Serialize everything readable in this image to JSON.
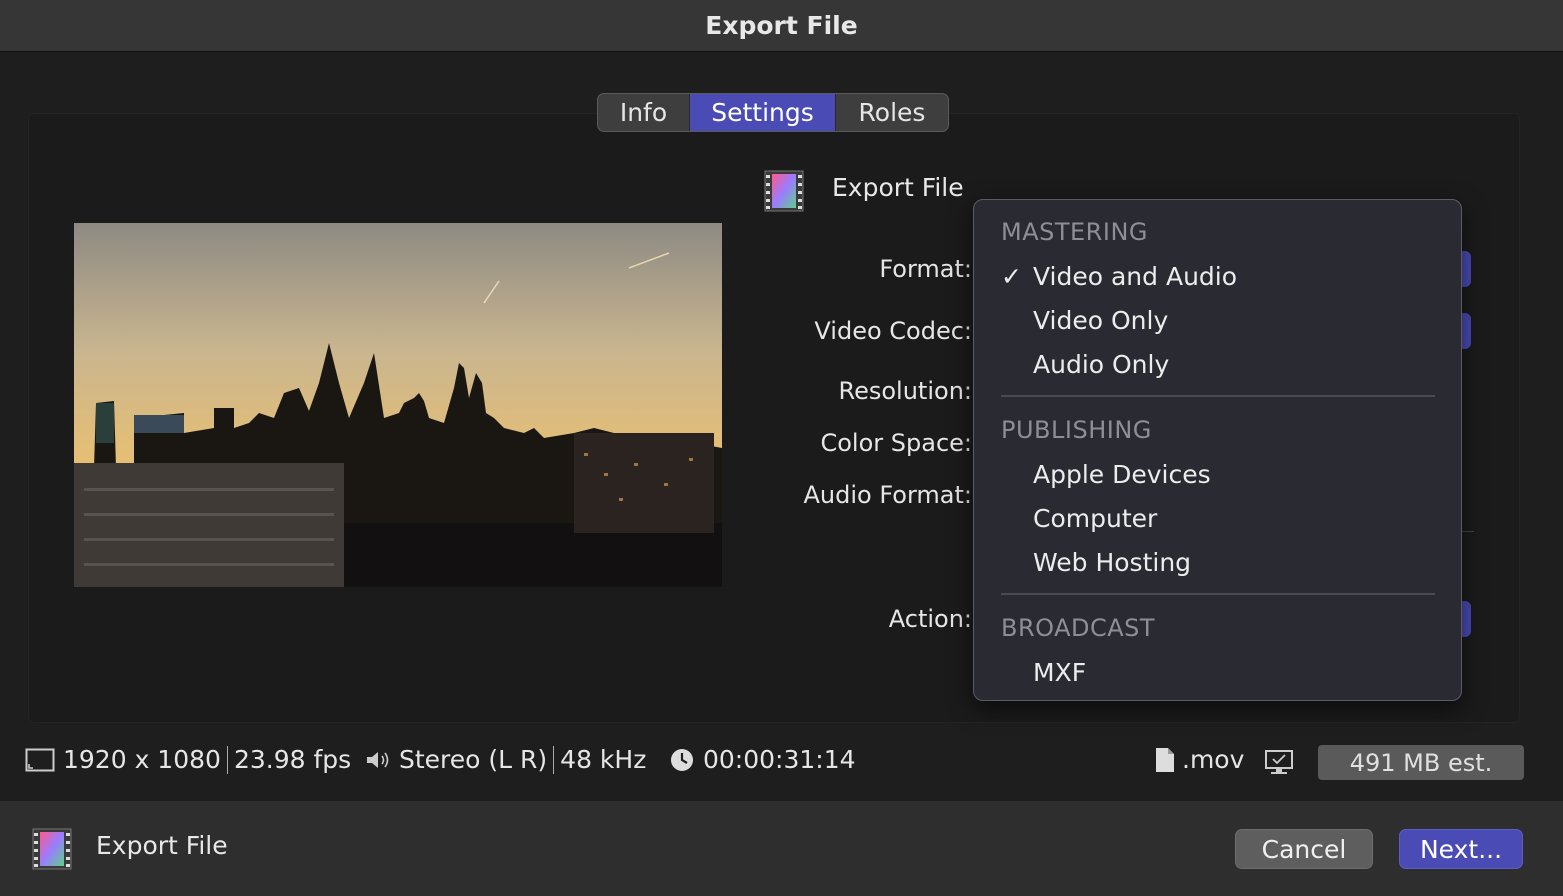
{
  "window": {
    "title": "Export File"
  },
  "tabs": [
    {
      "label": "Info",
      "active": false
    },
    {
      "label": "Settings",
      "active": true
    },
    {
      "label": "Roles",
      "active": false
    }
  ],
  "header": {
    "label": "Export File",
    "icon": "film-icon"
  },
  "settings": {
    "format_label": "Format:",
    "video_codec_label": "Video Codec:",
    "resolution_label": "Resolution:",
    "color_space_label": "Color Space:",
    "audio_format_label": "Audio Format:",
    "action_label": "Action:"
  },
  "format_menu": {
    "sections": [
      {
        "heading": "MASTERING",
        "items": [
          {
            "label": "Video and Audio",
            "checked": true
          },
          {
            "label": "Video Only",
            "checked": false
          },
          {
            "label": "Audio Only",
            "checked": false
          }
        ]
      },
      {
        "heading": "PUBLISHING",
        "items": [
          {
            "label": "Apple Devices",
            "checked": false
          },
          {
            "label": "Computer",
            "checked": false
          },
          {
            "label": "Web Hosting",
            "checked": false
          }
        ]
      },
      {
        "heading": "BROADCAST",
        "items": [
          {
            "label": "MXF",
            "checked": false
          }
        ]
      }
    ],
    "check_glyph": "✓"
  },
  "status": {
    "resolution": "1920 x 1080",
    "fps": "23.98 fps",
    "audio_channels": "Stereo (L R)",
    "sample_rate": "48 kHz",
    "duration": "00:00:31:14",
    "extension": ".mov",
    "size_estimate": "491 MB est."
  },
  "footer": {
    "label": "Export File",
    "cancel_label": "Cancel",
    "next_label": "Next..."
  },
  "colors": {
    "accent": "#4b4bb5",
    "background": "#1e1e1e"
  }
}
